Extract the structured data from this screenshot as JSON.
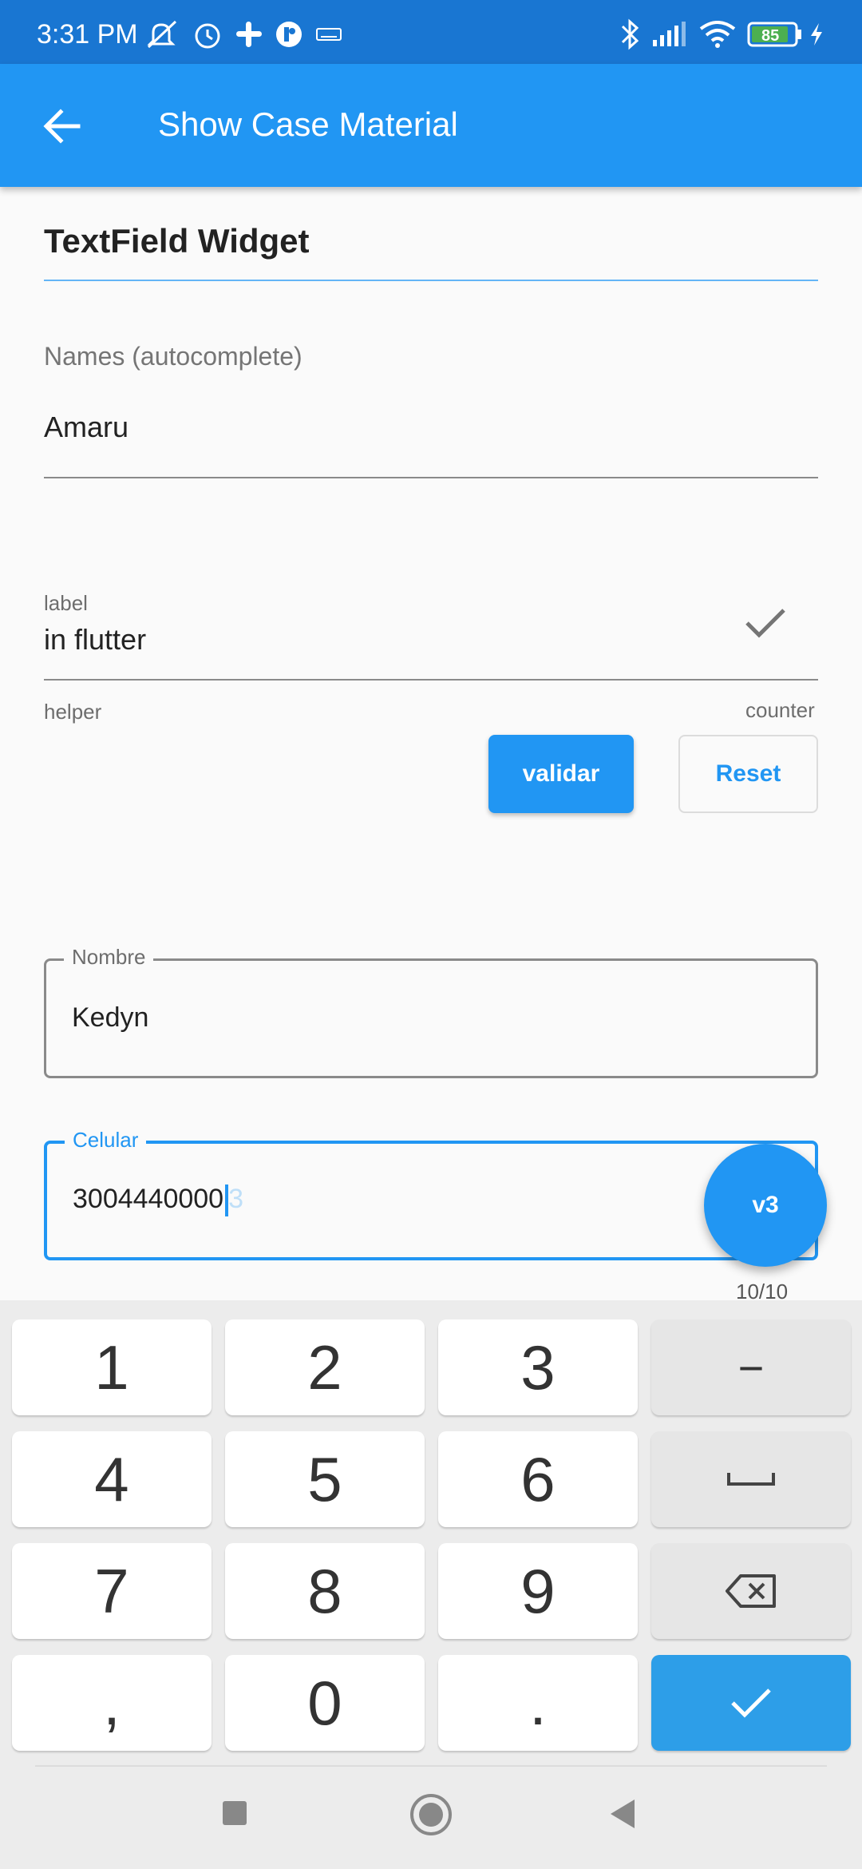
{
  "status_bar": {
    "time": "3:31 PM",
    "battery": "85",
    "icons": [
      "mute-icon",
      "alarm-icon",
      "slack-icon",
      "app-icon",
      "keyboard-icon",
      "bluetooth-icon",
      "signal-icon",
      "wifi-icon",
      "battery-icon",
      "charging-icon"
    ]
  },
  "app_bar": {
    "title": "Show Case Material"
  },
  "section": {
    "title": "TextField Widget"
  },
  "autocomplete": {
    "label": "Names (autocomplete)",
    "value": "Amaru"
  },
  "flutter_field": {
    "label": "label",
    "value": "in flutter",
    "helper": "helper",
    "counter": "counter"
  },
  "buttons": {
    "validar": "validar",
    "reset": "Reset"
  },
  "nombre_field": {
    "label": "Nombre",
    "value": "Kedyn"
  },
  "celular_field": {
    "label": "Celular",
    "value": "3004440000",
    "ghost": "3",
    "counter": "10/10"
  },
  "fab": {
    "label": "v3"
  },
  "keyboard": {
    "keys": [
      "1",
      "2",
      "3",
      "−",
      "4",
      "5",
      "6",
      "␣",
      "7",
      "8",
      "9",
      "⌫",
      ",",
      "0",
      ".",
      "✓"
    ]
  },
  "colors": {
    "primary": "#2196f3",
    "status_bar": "#1976d2",
    "background": "#fafafa"
  }
}
